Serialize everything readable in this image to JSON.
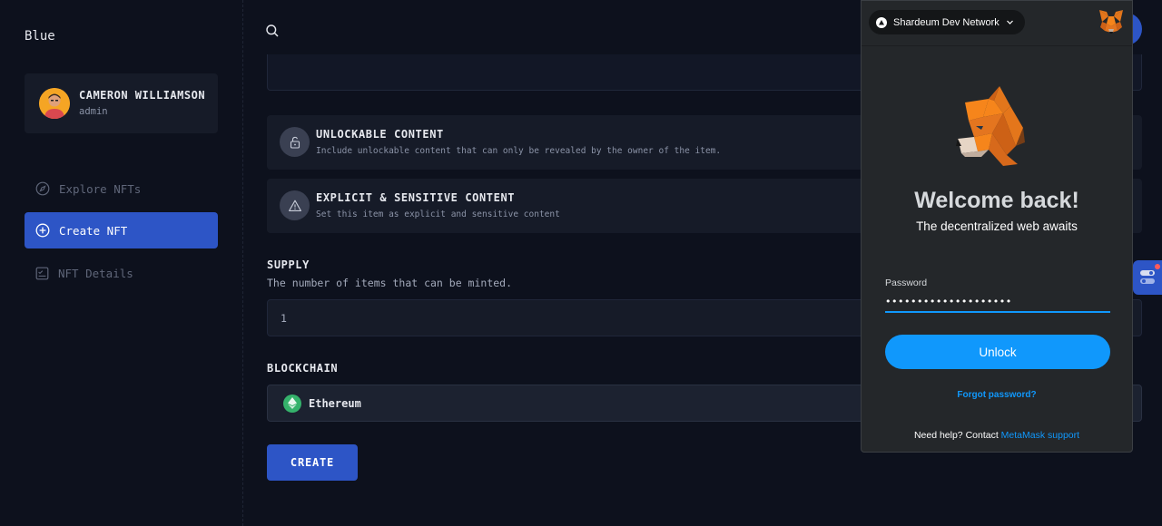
{
  "sidebar": {
    "brand": "Blue",
    "user": {
      "name": "CAMERON WILLIAMSON",
      "role": "admin"
    },
    "nav": [
      {
        "label": "Explore NFTs",
        "icon": "compass-icon",
        "active": false
      },
      {
        "label": "Create NFT",
        "icon": "plus-circle-icon",
        "active": true
      },
      {
        "label": "NFT Details",
        "icon": "checklist-icon",
        "active": false
      }
    ]
  },
  "form": {
    "options": [
      {
        "title": "UNLOCKABLE CONTENT",
        "description": "Include unlockable content that can only be revealed by the owner of the item.",
        "icon": "lock-icon"
      },
      {
        "title": "EXPLICIT & SENSITIVE CONTENT",
        "description": "Set this item as explicit and sensitive content",
        "icon": "warning-icon"
      }
    ],
    "supply": {
      "label": "SUPPLY",
      "help": "The number of items that can be minted.",
      "value": "1"
    },
    "blockchain": {
      "label": "BLOCKCHAIN",
      "selected": "Ethereum"
    },
    "create_label": "CREATE"
  },
  "metamask": {
    "network": "Shardeum Dev Network",
    "title": "Welcome back!",
    "subtitle": "The decentralized web awaits",
    "password_label": "Password",
    "password_value": "••••••••••••••••••••",
    "unlock_label": "Unlock",
    "forgot_label": "Forgot password?",
    "help_prefix": "Need help? Contact ",
    "help_link": "MetaMask support"
  },
  "colors": {
    "accent": "#2d55c6",
    "metamask_blue": "#1098fc",
    "background": "#0d111d"
  }
}
